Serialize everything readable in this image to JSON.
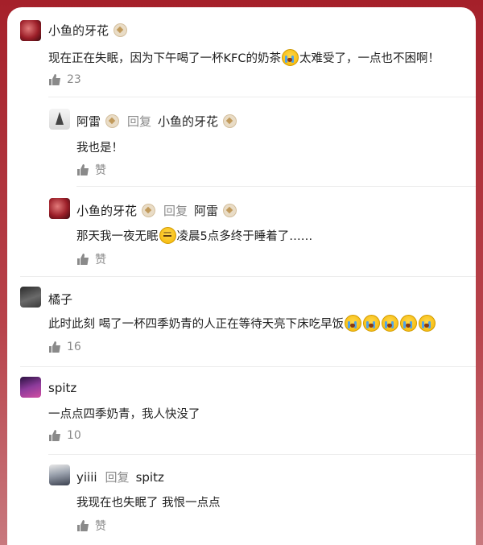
{
  "comments": [
    {
      "user": "小鱼的牙花",
      "text": "现在正在失眠，因为下午喝了一杯KFC的奶茶",
      "text_after": "太难受了，一点也不困啊！",
      "likes": "23",
      "replies": [
        {
          "user": "阿雷",
          "reply_word": "回复",
          "reply_to": "小鱼的牙花",
          "text": "我也是！",
          "like_label": "赞"
        },
        {
          "user": "小鱼的牙花",
          "reply_word": "回复",
          "reply_to": "阿雷",
          "text": "那天我一夜无眠",
          "text_after": "凌晨5点多终于睡着了……",
          "like_label": "赞"
        }
      ]
    },
    {
      "user": "橘子",
      "text": "此时此刻 喝了一杯四季奶青的人正在等待天亮下床吃早饭",
      "likes": "16"
    },
    {
      "user": "spitz",
      "text": "一点点四季奶青，我人快没了",
      "likes": "10",
      "replies": [
        {
          "user": "yiiii",
          "reply_word": "回复",
          "reply_to": "spitz",
          "text": "我现在也失眠了 我恨一点点",
          "like_label": "赞"
        }
      ]
    }
  ],
  "icons": {
    "like": "thumbs-up-icon",
    "badge": "level-badge-icon",
    "cry": "crying-emoji-icon",
    "sleep": "sleeping-emoji-icon"
  },
  "colors": {
    "frame": "#a5202a",
    "muted_text": "#8a8a8a",
    "badge": "#c19a5b"
  }
}
